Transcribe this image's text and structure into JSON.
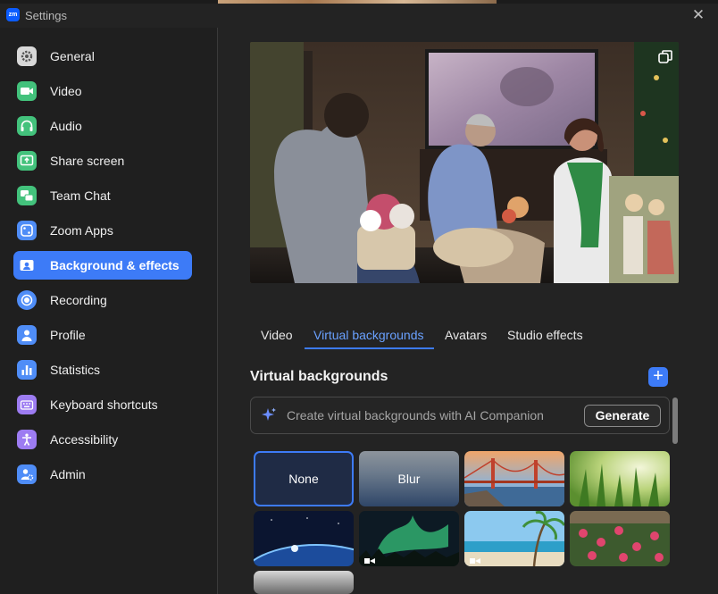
{
  "window": {
    "title": "Settings",
    "logo_text": "zm"
  },
  "sidebar": {
    "items": [
      {
        "label": "General",
        "icon": "gear-icon",
        "color": "#d8d8d8"
      },
      {
        "label": "Video",
        "icon": "video-camera-icon",
        "color": "#43c27c"
      },
      {
        "label": "Audio",
        "icon": "headphones-icon",
        "color": "#43c27c"
      },
      {
        "label": "Share screen",
        "icon": "share-screen-icon",
        "color": "#43c27c"
      },
      {
        "label": "Team Chat",
        "icon": "chat-bubbles-icon",
        "color": "#43c27c"
      },
      {
        "label": "Zoom Apps",
        "icon": "zoom-apps-icon",
        "color": "#4f8df7"
      },
      {
        "label": "Background & effects",
        "icon": "person-card-icon",
        "color": "#ffffff"
      },
      {
        "label": "Recording",
        "icon": "record-icon",
        "color": "#4f8df7"
      },
      {
        "label": "Profile",
        "icon": "profile-icon",
        "color": "#4f8df7"
      },
      {
        "label": "Statistics",
        "icon": "bar-chart-icon",
        "color": "#4f8df7"
      },
      {
        "label": "Keyboard shortcuts",
        "icon": "keyboard-icon",
        "color": "#9d7cf2"
      },
      {
        "label": "Accessibility",
        "icon": "accessibility-icon",
        "color": "#9d7cf2"
      },
      {
        "label": "Admin",
        "icon": "admin-user-gear-icon",
        "color": "#4f8df7"
      }
    ],
    "active_index": 6
  },
  "tabs": [
    {
      "label": "Video"
    },
    {
      "label": "Virtual backgrounds",
      "active": true
    },
    {
      "label": "Avatars"
    },
    {
      "label": "Studio effects"
    }
  ],
  "section": {
    "title": "Virtual backgrounds"
  },
  "ai_companion": {
    "placeholder": "Create virtual backgrounds with AI Companion",
    "generate_label": "Generate"
  },
  "backgrounds": [
    {
      "label": "None",
      "selected": true
    },
    {
      "label": "Blur"
    },
    {
      "label": "",
      "name": "golden-gate-bridge"
    },
    {
      "label": "",
      "name": "green-grass"
    },
    {
      "label": "",
      "name": "earth-from-space"
    },
    {
      "label": "",
      "name": "aurora",
      "video": true
    },
    {
      "label": "",
      "name": "beach-palm",
      "video": true
    },
    {
      "label": "",
      "name": "flowers"
    }
  ],
  "colors": {
    "accent": "#3d7bf7",
    "active_tab": "#6aa1ff",
    "window_bg": "#232323"
  }
}
